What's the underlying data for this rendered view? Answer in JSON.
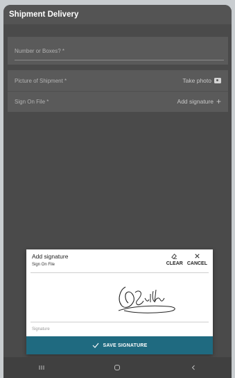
{
  "header": {
    "title": "Shipment Delivery"
  },
  "form": {
    "boxes_label": "Number or Boxes? *",
    "picture_label": "Picture of Shipment *",
    "picture_action": "Take photo",
    "sign_label": "Sign On File *",
    "sign_action": "Add signature"
  },
  "dialog": {
    "title": "Add signature",
    "subtitle": "Sign On File",
    "clear_label": "CLEAR",
    "cancel_label": "CANCEL",
    "signature_label": "Signature",
    "save_label": "SAVE SIGNATURE"
  },
  "icons": {
    "camera": "camera-icon",
    "plus": "plus-icon",
    "eraser": "eraser-icon",
    "close": "close-icon",
    "check": "check-icon",
    "nav": [
      "recent-apps-icon",
      "home-icon",
      "back-icon"
    ]
  },
  "colors": {
    "accent": "#1f6a80",
    "header_bg": "#545454",
    "overlay": "#4a4a4a"
  }
}
